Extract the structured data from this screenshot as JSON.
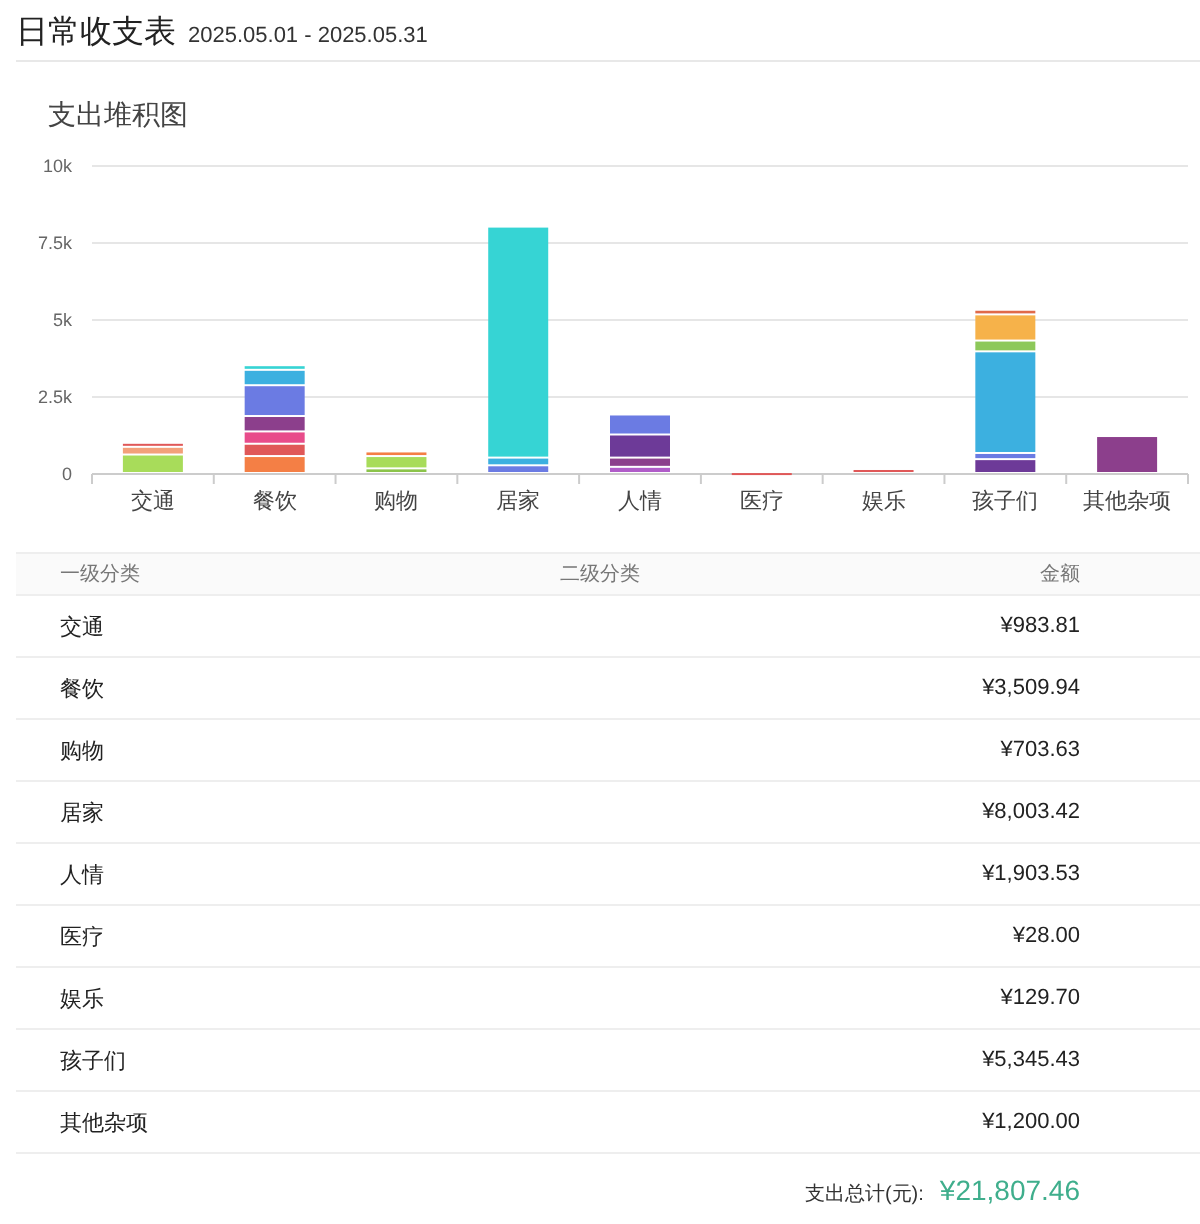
{
  "header": {
    "title": "日常收支表",
    "date_range": "2025.05.01 - 2025.05.31"
  },
  "chart_card": {
    "title": "支出堆积图",
    "chart_data": {
      "type": "bar",
      "stacked": true,
      "grid": true,
      "categories": [
        "交通",
        "餐饮",
        "购物",
        "居家",
        "人情",
        "医疗",
        "娱乐",
        "孩子们",
        "其他杂项"
      ],
      "ylim": [
        0,
        10000
      ],
      "yticks": [
        0,
        {
          "value": 2500,
          "label": "2.5k"
        },
        {
          "value": 5000,
          "label": "5k"
        },
        {
          "value": 7500,
          "label": "7.5k"
        },
        {
          "value": 10000,
          "label": "10k"
        }
      ],
      "series": [
        {
          "color": "#8bc34a",
          "values": [
            null,
            null,
            150,
            null,
            null,
            null,
            null,
            null,
            null
          ]
        },
        {
          "color": "#a8dc5a",
          "values": [
            600,
            null,
            400,
            null,
            null,
            null,
            null,
            null,
            null
          ]
        },
        {
          "color": "#f47f45",
          "values": [
            null,
            550,
            150,
            null,
            null,
            null,
            null,
            null,
            null
          ]
        },
        {
          "color": "#f3a07a",
          "values": [
            250,
            null,
            null,
            null,
            null,
            null,
            null,
            null,
            null
          ]
        },
        {
          "color": "#e05858",
          "values": [
            130,
            400,
            null,
            null,
            null,
            30,
            130,
            null,
            null
          ]
        },
        {
          "color": "#e84c8b",
          "values": [
            null,
            400,
            null,
            null,
            null,
            null,
            null,
            null,
            null
          ]
        },
        {
          "color": "#b05cc8",
          "values": [
            null,
            null,
            null,
            null,
            200,
            null,
            null,
            null,
            null
          ]
        },
        {
          "color": "#8c3f8c",
          "values": [
            null,
            500,
            null,
            null,
            300,
            null,
            null,
            null,
            1200
          ]
        },
        {
          "color": "#6d3a98",
          "values": [
            null,
            null,
            null,
            null,
            750,
            null,
            null,
            450,
            null
          ]
        },
        {
          "color": "#6b7be3",
          "values": [
            null,
            1000,
            null,
            250,
            650,
            null,
            null,
            200,
            null
          ]
        },
        {
          "color": "#3cb0e0",
          "values": [
            null,
            500,
            null,
            250,
            null,
            null,
            null,
            3300,
            null
          ]
        },
        {
          "color": "#36d4d4",
          "values": [
            null,
            150,
            null,
            7500,
            null,
            null,
            null,
            null,
            null
          ]
        },
        {
          "color": "#8dc85a",
          "values": [
            null,
            null,
            null,
            null,
            null,
            null,
            null,
            350,
            null
          ]
        },
        {
          "color": "#f6b24a",
          "values": [
            null,
            null,
            null,
            null,
            null,
            null,
            null,
            850,
            null
          ]
        },
        {
          "color": "#e06a4a",
          "values": [
            null,
            null,
            null,
            null,
            null,
            null,
            null,
            150,
            null
          ]
        }
      ]
    }
  },
  "table": {
    "columns": [
      "一级分类",
      "二级分类",
      "金额"
    ],
    "rows": [
      {
        "category": "交通",
        "amount": "¥983.81"
      },
      {
        "category": "餐饮",
        "amount": "¥3,509.94"
      },
      {
        "category": "购物",
        "amount": "¥703.63"
      },
      {
        "category": "居家",
        "amount": "¥8,003.42"
      },
      {
        "category": "人情",
        "amount": "¥1,903.53"
      },
      {
        "category": "医疗",
        "amount": "¥28.00"
      },
      {
        "category": "娱乐",
        "amount": "¥129.70"
      },
      {
        "category": "孩子们",
        "amount": "¥5,345.43"
      },
      {
        "category": "其他杂项",
        "amount": "¥1,200.00"
      }
    ]
  },
  "total": {
    "label": "支出总计(元):",
    "value": "¥21,807.46"
  }
}
